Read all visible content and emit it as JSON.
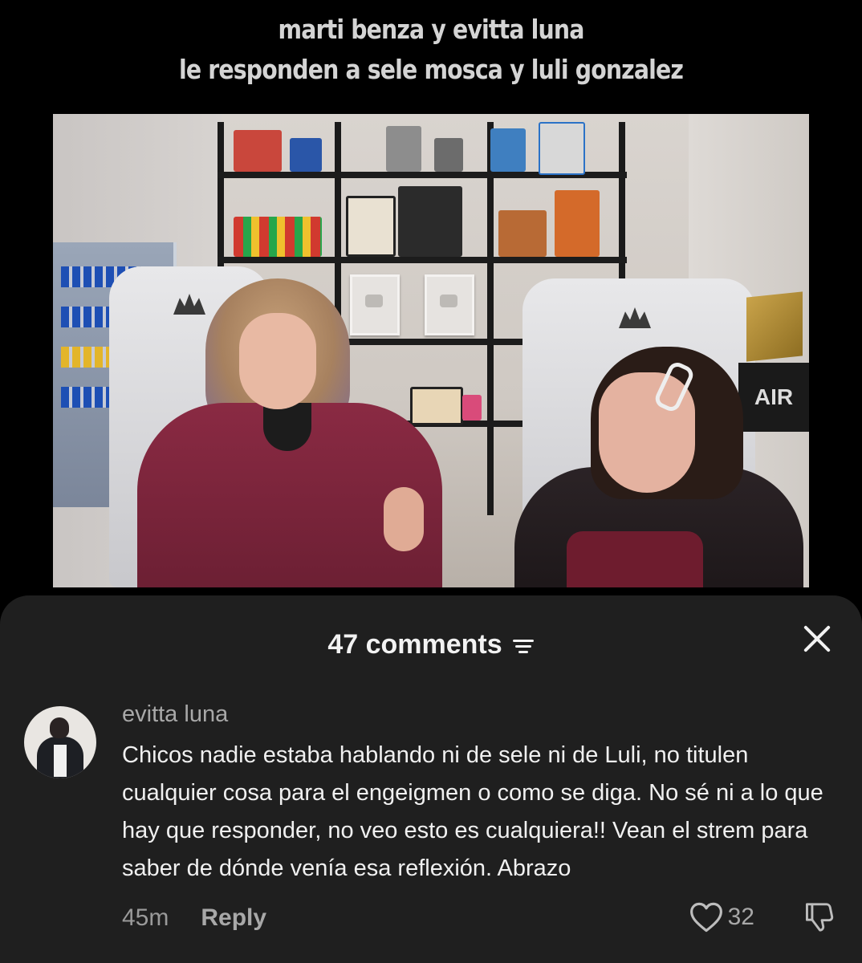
{
  "caption": {
    "line1": "marti benza y evitta luna",
    "line2": "le responden a sele mosca y luli gonzalez"
  },
  "video": {
    "sign_text": "AIR"
  },
  "comments_sheet": {
    "count_label": "47 comments",
    "filter_icon": "filter-sort-icon",
    "close_icon": "close-icon"
  },
  "comment": {
    "author": "evitta luna",
    "text": "Chicos nadie estaba hablando ni de sele ni de Luli, no titulen cualquier cosa para el engeigmen o como se diga. No sé ni a lo que hay que responder, no veo esto es cualquiera!! Vean el strem para saber de dónde venía esa reflexión. Abrazo",
    "time": "45m",
    "reply_label": "Reply",
    "like_count": "32",
    "like_icon": "heart-outline-icon",
    "dislike_icon": "thumbs-down-icon"
  }
}
